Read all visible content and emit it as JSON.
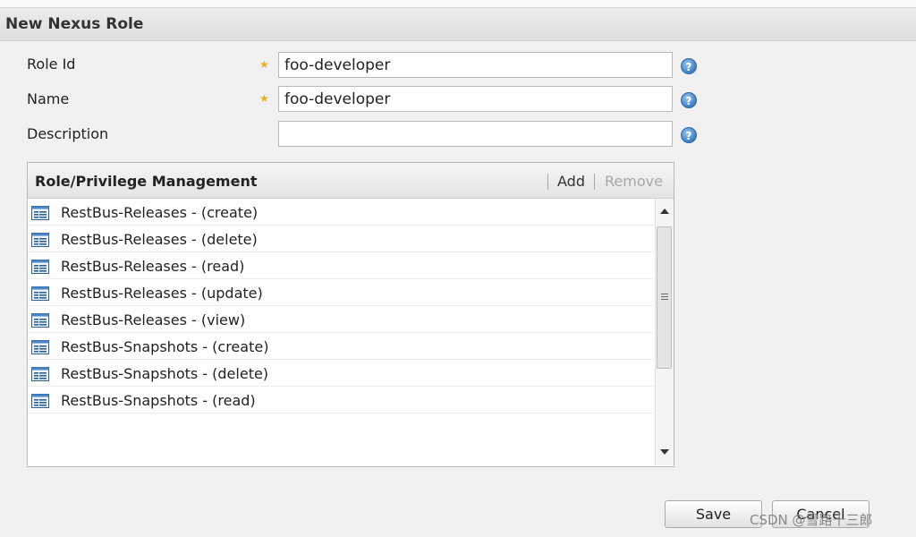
{
  "panel": {
    "title": "New Nexus Role"
  },
  "form": {
    "role_id": {
      "label": "Role Id",
      "value": "foo-developer",
      "required": true
    },
    "name": {
      "label": "Name",
      "value": "foo-developer",
      "required": true
    },
    "description": {
      "label": "Description",
      "value": "",
      "required": false
    },
    "required_mark": "★",
    "help_glyph": "?"
  },
  "privileges": {
    "title": "Role/Privilege Management",
    "add_label": "Add",
    "remove_label": "Remove",
    "items": [
      "RestBus-Releases - (create)",
      "RestBus-Releases - (delete)",
      "RestBus-Releases - (read)",
      "RestBus-Releases - (update)",
      "RestBus-Releases - (view)",
      "RestBus-Snapshots - (create)",
      "RestBus-Snapshots - (delete)",
      "RestBus-Snapshots - (read)"
    ],
    "item_icon": "privilege-list-icon"
  },
  "actions": {
    "save_label": "Save",
    "cancel_label": "Cancel"
  },
  "watermark": "CSDN @雪路十三郎",
  "colors": {
    "required_star": "#e8b020",
    "help_icon": "#3c7ec5",
    "remove_disabled": "#a8a8a8"
  }
}
